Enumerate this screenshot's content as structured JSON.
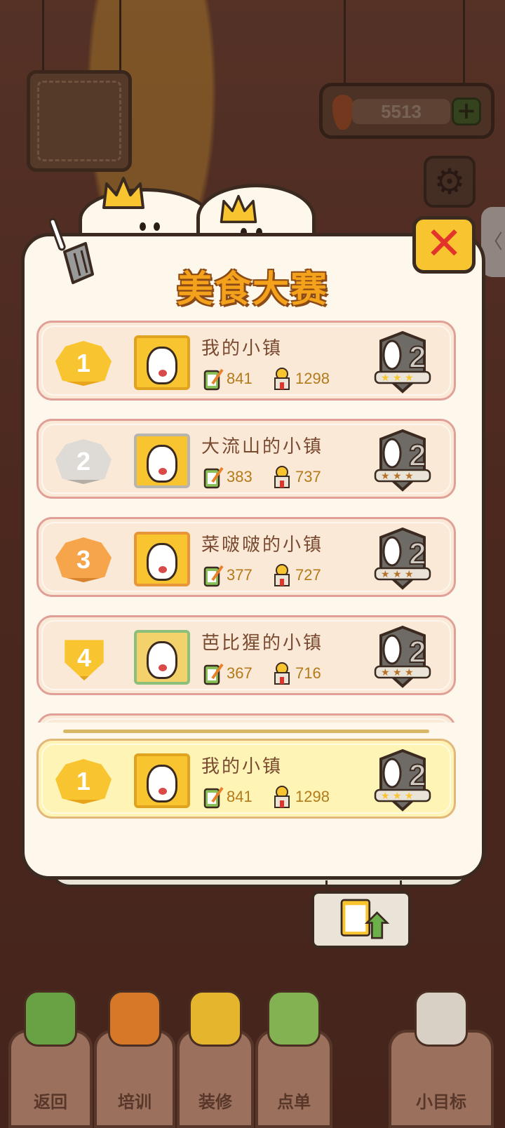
{
  "header": {
    "coins": "5513",
    "plus_label": "+"
  },
  "popup": {
    "title": "美食大赛",
    "close_label": "✕"
  },
  "ranking": [
    {
      "rank": "1",
      "name": "我的小镇",
      "score_a": "841",
      "score_b": "1298",
      "rank_color": "#f8c531",
      "rank_edge": "#e8a51c",
      "avatar_bg": "#f8c531",
      "avatar_border": "#e0a31f"
    },
    {
      "rank": "2",
      "name": "大流山的小镇",
      "score_a": "383",
      "score_b": "737",
      "rank_color": "#dedad5",
      "rank_edge": "#b4aea7",
      "avatar_bg": "#f8c531",
      "avatar_border": "#b8b4ae"
    },
    {
      "rank": "3",
      "name": "菜啵啵的小镇",
      "score_a": "377",
      "score_b": "727",
      "rank_color": "#f6a54b",
      "rank_edge": "#d9822d",
      "avatar_bg": "#f8c531",
      "avatar_border": "#e8953a"
    },
    {
      "rank": "4",
      "name": "芭比猩的小镇",
      "score_a": "367",
      "score_b": "716",
      "rank_color": "#f8c531",
      "rank_edge": "#e0a31f",
      "avatar_bg": "#f4d26b",
      "avatar_border": "#8cbf7a"
    }
  ],
  "my_rank": {
    "rank": "1",
    "name": "我的小镇",
    "score_a": "841",
    "score_b": "1298",
    "rank_color": "#f8c531",
    "rank_edge": "#e8a51c"
  },
  "bottom_nav": [
    {
      "label": "返回",
      "icon": "back-arrow-icon"
    },
    {
      "label": "培训",
      "icon": "carrot-muscle-icon"
    },
    {
      "label": "装修",
      "icon": "builder-bunny-icon"
    },
    {
      "label": "点单",
      "icon": "order-list-icon"
    },
    {
      "label": "小目标",
      "icon": "flag-paw-icon"
    }
  ]
}
